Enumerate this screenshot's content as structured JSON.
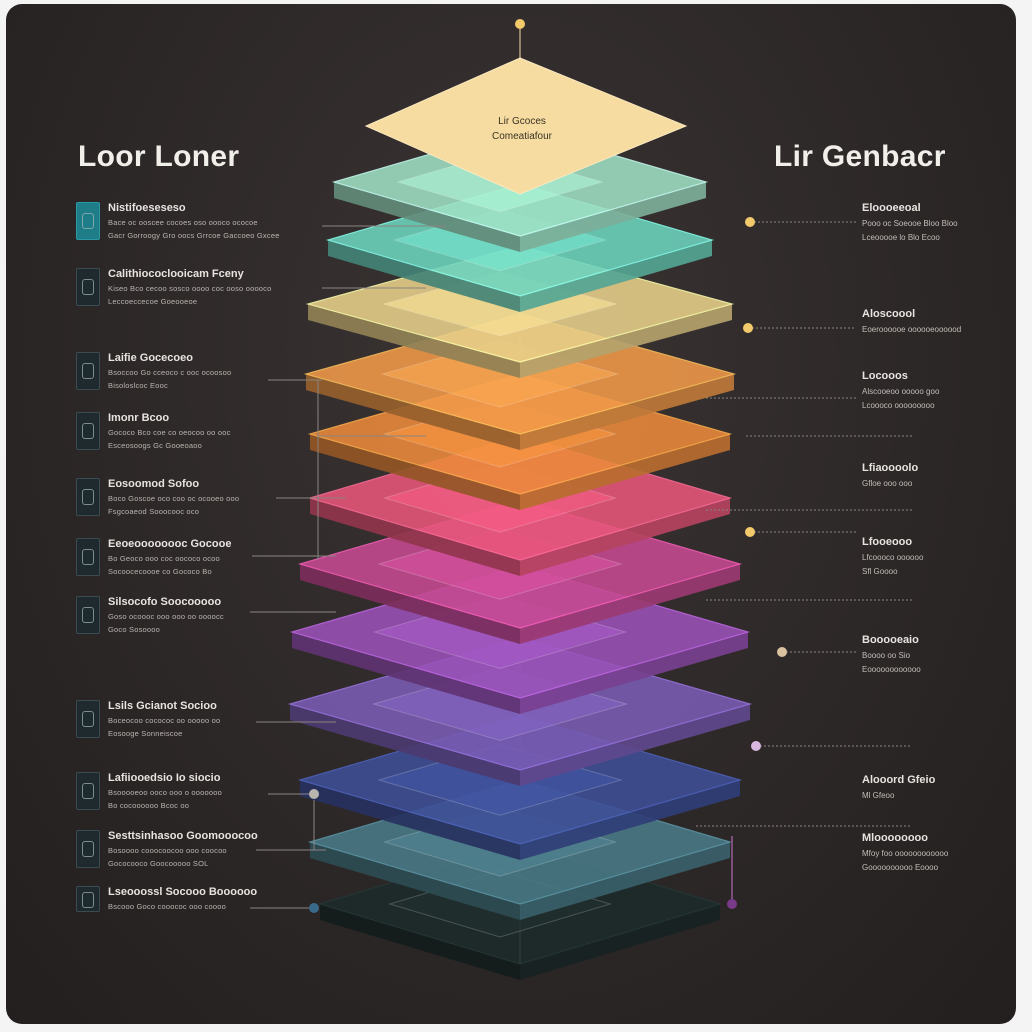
{
  "headings": {
    "left": "Loor Loner",
    "right": "Lir Genbacr"
  },
  "top_layer": {
    "line1": "Lir Gcoces",
    "line2": "Comeatiafour"
  },
  "colors": {
    "background": "#2c2727",
    "layers": [
      "#f6dca0",
      "#9fe0c4",
      "#6cd4be",
      "#e8d08a",
      "#f29a4a",
      "#ec8a3c",
      "#e8567a",
      "#c64a92",
      "#9a52b8",
      "#7a5cb4",
      "#3e4f98",
      "#4a7a88",
      "#1d2b2b"
    ]
  },
  "left_items": [
    {
      "title": "Nistifoeseseso",
      "line1": "Bace oc ooscee cocoes oso oooco ococoe",
      "line2": "Gacr Gorroogy Gro oocs Grrcoe Gaccoeo Gxcee",
      "icon": "phone-icon"
    },
    {
      "title": "Calithiococlooicam Fceny",
      "line1": "Kiseo Bco cecoo sosco oooo coc ooso ooooco",
      "line2": "Leccoeccecoe Goeooeoe",
      "icon": "chip-icon"
    },
    {
      "title": "Laifie Gocecoeo",
      "line1": "Bsoccoo Go cceoco c ooc ocoosoo",
      "line2": "Bisoloslcoc Eooc",
      "icon": "server-icon"
    },
    {
      "title": "Imonr Bcoo",
      "line1": "Gococo Bco coe co oeocoo oo ooc",
      "line2": "Esceosoogs Gc Gooeoaoo",
      "icon": "lock-icon"
    },
    {
      "title": "Eosoomod Sofoo",
      "line1": "Boco Goscoe oco coo oc ocooeo ooo",
      "line2": "Fsgcoaeod Sooocooc oco",
      "icon": "bag-icon"
    },
    {
      "title": "Eeoeoooooooc Gocooe",
      "line1": "Bo Geoco ooo coc oococo ocoo",
      "line2": "Socoocecoooe co Gococo Bo",
      "icon": "gear-icon"
    },
    {
      "title": "Silsocofo Soocooooo",
      "line1": "Goso ocoooc ooo ooo oo oooocc",
      "line2": "Goco Sosoooo",
      "icon": "user-icon"
    },
    {
      "title": "Lsils Gcianot Socioo",
      "line1": "Boceocoo cocococ oo ooooo oo",
      "line2": "Eosooge Sonneiscoe",
      "icon": "card-icon"
    },
    {
      "title": "Lafiiooedsio Io siocio",
      "line1": "Bsooooeoo ooco ooo o ooooooo",
      "line2": "Bo cocoooooo Bcoc oo",
      "icon": "tools-icon"
    },
    {
      "title": "Sesttsinhasoo Goomooocoo",
      "line1": "Bosoooo cooocoocoo ooo coocoo",
      "line2": "Gococooco Goocooooo SOL",
      "icon": "box-icon"
    },
    {
      "title": "Lseooossl Socooo Boooooo",
      "line1": "Bscooo Goco cooococ ooo coooo",
      "line2": "",
      "icon": "dish-icon"
    }
  ],
  "right_items": [
    {
      "title": "Eloooeeoal",
      "line1": "Pooo oc Soeooe Bloo Bloo",
      "line2": "Lceooooe lo Blo Ecoo"
    },
    {
      "title": "Aloscoool",
      "line1": "Eoeroooooe oooooeoooood",
      "line2": ""
    },
    {
      "title": "Locooos",
      "line1": "Alscooeoo ooooo goo",
      "line2": "Lcoooco ooooooooo"
    },
    {
      "title": "Lfiaoooolo",
      "line1": "Gfloe ooo ooo",
      "line2": ""
    },
    {
      "title": "Lfooeooo",
      "line1": "Lfcoooco oooooo",
      "line2": "Sfl Goooo"
    },
    {
      "title": "Booooeaio",
      "line1": "Boooo oo Sio",
      "line2": "Eoooooooooooo"
    },
    {
      "title": "Alooord Gfeio",
      "line1": "Ml Gfeoo",
      "line2": ""
    },
    {
      "title": "Mloooooooo",
      "line1": "Mfoy foo oooooooooooo",
      "line2": "Goooooooooo Eoooo"
    }
  ]
}
